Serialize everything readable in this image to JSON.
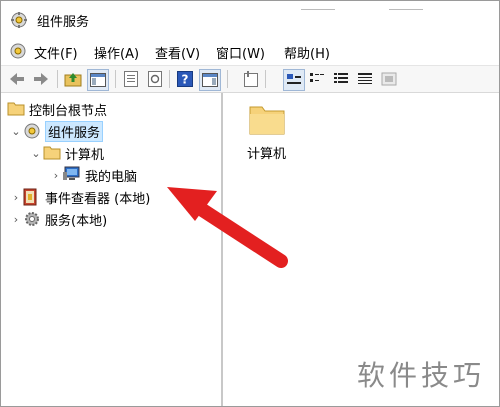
{
  "window": {
    "title": "组件服务"
  },
  "menu": [
    "文件(F)",
    "操作(A)",
    "查看(V)",
    "窗口(W)",
    "帮助(H)"
  ],
  "toolbar": {
    "icons": [
      "back-arrow-icon",
      "forward-arrow-icon",
      "up-folder-icon",
      "console-tree-icon",
      "properties-icon",
      "refresh-icon",
      "help-icon",
      "action-pane-icon",
      "export-list-icon",
      "large-icons-view-icon",
      "small-icons-view-icon",
      "list-view-icon",
      "details-view-icon",
      "stop-icon"
    ]
  },
  "tree": {
    "root": "控制台根节点",
    "component_services": "组件服务",
    "computers": "计算机",
    "my_computer": "我的电脑",
    "event_viewer": "事件查看器 (本地)",
    "services": "服务(本地)"
  },
  "right_pane": {
    "items": [
      {
        "label": "计算机",
        "icon": "folder-icon"
      }
    ]
  },
  "watermark": "软件技巧",
  "colors": {
    "selection": "#cce8ff",
    "annotation_arrow": "#e32020",
    "folder": "#f6d27a"
  }
}
